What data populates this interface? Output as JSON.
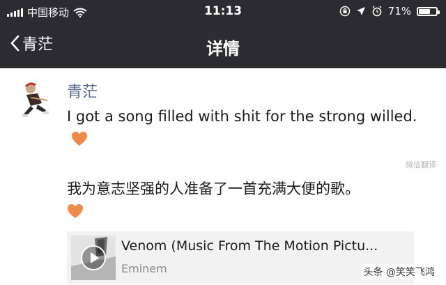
{
  "status_bar": {
    "carrier": "中国移动",
    "time": "11:13",
    "battery": "71%",
    "battery_level": 0.71,
    "icons": [
      "signal-bars-icon",
      "wifi-icon",
      "screen-lock-icon",
      "location-arrow-icon",
      "alarm-icon",
      "battery-icon"
    ]
  },
  "nav": {
    "back_label": "青茫",
    "title": "详情"
  },
  "post": {
    "nickname": "青茫",
    "text_en": "I got a song filled with shit for the strong willed.",
    "translate_label": "微信翻译",
    "text_cn": "我为意志坚强的人准备了一首充满大便的歌。",
    "emoji": "orange-heart-icon"
  },
  "music_card": {
    "title": "Venom (Music From The Motion Pictu...",
    "artist": "Eminem"
  },
  "watermark": "头条 @笑笑飞鸿",
  "colors": {
    "topbar": "#2c2c2e",
    "nickname": "#57698f",
    "heart": "#f08a4b"
  }
}
